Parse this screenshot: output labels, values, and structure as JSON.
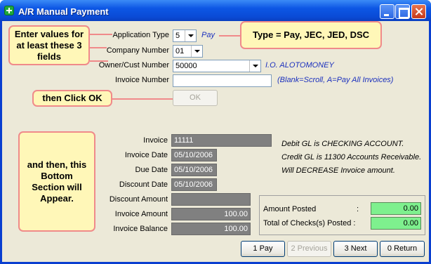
{
  "window": {
    "title": "A/R Manual Payment"
  },
  "colors": {
    "callout_bg": "#fff7b8",
    "callout_border": "#f08a8a",
    "posted_bg": "#7ef08e",
    "link_text": "#1a2fbd"
  },
  "header": {
    "application_type": {
      "label": "Application Type",
      "value": "5",
      "hint": "Pay"
    },
    "company_number": {
      "label": "Company Number",
      "value": "01"
    },
    "owner_cust_number": {
      "label": "Owner/Cust Number",
      "value": "50000",
      "name": "I.O. ALOTOMONEY"
    },
    "invoice_number": {
      "label": "Invoice Number",
      "value": "",
      "hint": "(Blank=Scroll,  A=Pay All Invoices)"
    },
    "ok_label": "OK"
  },
  "callouts": {
    "enter_values": "Enter values for at least these 3 fields",
    "type_info": "Type = Pay, JEC, JED, DSC",
    "click_ok": "then Click OK",
    "bottom_section": "and then, this Bottom Section will Appear."
  },
  "detail": {
    "invoice": {
      "label": "Invoice",
      "value": "11111"
    },
    "invoice_date": {
      "label": "Invoice Date",
      "value": "05/10/2006"
    },
    "due_date": {
      "label": "Due Date",
      "value": "05/10/2006"
    },
    "discount_date": {
      "label": "Discount Date",
      "value": "05/10/2006"
    },
    "discount_amount": {
      "label": "Discount Amount",
      "value": ""
    },
    "invoice_amount": {
      "label": "Invoice Amount",
      "value": "100.00"
    },
    "invoice_balance": {
      "label": "Invoice Balance",
      "value": "100.00"
    }
  },
  "gl_notes": {
    "debit": "Debit  GL is CHECKING ACCOUNT.",
    "credit": "Credit GL is 11300 Accounts Receivable.",
    "decrease": "Will DECREASE Invoice amount."
  },
  "summary": {
    "amount_posted": {
      "label": "Amount Posted",
      "colon": ":",
      "value": "0.00"
    },
    "total_checks": {
      "label": "Total of Checks(s) Posted :",
      "value": "0.00"
    }
  },
  "buttons": {
    "pay": "1 Pay",
    "previous": "2 Previous",
    "next": "3 Next",
    "return": "0 Return"
  }
}
